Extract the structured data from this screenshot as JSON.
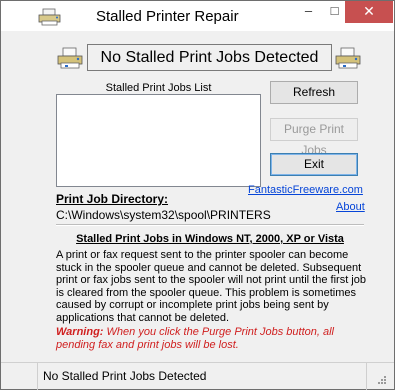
{
  "window": {
    "title": "Stalled Printer Repair",
    "minimize_glyph": "–",
    "maximize_glyph": "□",
    "close_glyph": "✕"
  },
  "banner": {
    "status": "No Stalled Print Jobs Detected",
    "left_icon": "printer-icon",
    "right_icon": "printer-icon"
  },
  "jobs_list": {
    "label": "Stalled Print Jobs List",
    "items": []
  },
  "buttons": {
    "refresh": "Refresh",
    "purge": "Purge Print Jobs",
    "exit": "Exit"
  },
  "directory": {
    "label": "Print Job Directory:",
    "path": "C:\\Windows\\system32\\spool\\PRINTERS"
  },
  "links": {
    "site": "FantasticFreeware.com",
    "about": "About"
  },
  "info": {
    "heading": "Stalled Print Jobs in Windows NT, 2000, XP or Vista",
    "body": "A print or fax request sent to the printer spooler can become stuck in the spooler queue and cannot be deleted. Subsequent print or fax jobs sent to the spooler will not print until the first job is cleared from the spooler queue. This problem is sometimes caused by corrupt or incomplete print jobs being sent by applications that cannot be deleted.",
    "warning_label": "Warning:",
    "warning_text": "When you click the Purge Print Jobs button, all pending fax and print jobs will be lost."
  },
  "statusbar": {
    "text": "No Stalled Print Jobs Detected"
  },
  "colors": {
    "link": "#0645d8",
    "warning": "#d02020",
    "close_button": "#c75050"
  }
}
